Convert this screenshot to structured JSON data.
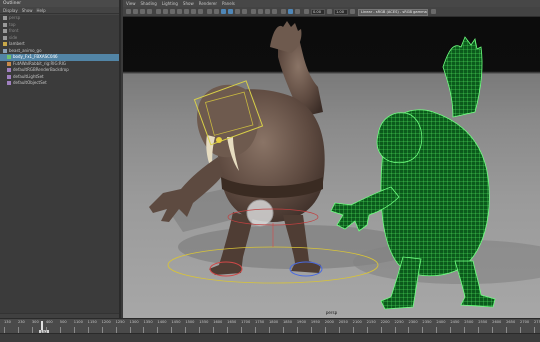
{
  "outliner": {
    "title": "Outliner",
    "menu": [
      "Display",
      "Show",
      "Help"
    ],
    "items": [
      {
        "label": "persp",
        "dim": true,
        "indent": 0,
        "icon": "camera-icon"
      },
      {
        "label": "top",
        "dim": true,
        "indent": 0,
        "icon": "camera-icon"
      },
      {
        "label": "front",
        "dim": true,
        "indent": 0,
        "icon": "camera-icon"
      },
      {
        "label": "side",
        "dim": true,
        "indent": 0,
        "icon": "camera-icon"
      },
      {
        "label": "lambert",
        "dim": false,
        "indent": 0,
        "icon": "folder-icon"
      },
      {
        "label": "beast_animo_go",
        "dim": false,
        "indent": 0,
        "icon": "group-icon"
      },
      {
        "label": "body_Fx1_FBXASC046",
        "dim": false,
        "indent": 1,
        "icon": "mesh-icon",
        "selected": true
      },
      {
        "label": "FutAWalRabbit_rig:RIG:RIG",
        "dim": false,
        "indent": 1,
        "icon": "joint-icon"
      },
      {
        "label": "defaultRGBRenderBackdrop",
        "dim": false,
        "indent": 1,
        "icon": "set-icon"
      },
      {
        "label": "defaultLightSet",
        "dim": false,
        "indent": 1,
        "icon": "set-icon"
      },
      {
        "label": "defaultObjectSet",
        "dim": false,
        "indent": 1,
        "icon": "set-icon"
      }
    ]
  },
  "viewport": {
    "menu": [
      "View",
      "Shading",
      "Lighting",
      "Show",
      "Renderer",
      "Panels"
    ],
    "field1": "0.00",
    "field2": "1.00",
    "color_space": "Linear - sRGB (ACES) - sRGB gamma (ACES)",
    "camera_label": "persp"
  },
  "timeline": {
    "ticks": [
      "130",
      "230",
      "300",
      "400",
      "500",
      "1100",
      "1150",
      "1200",
      "1250",
      "1300",
      "1350",
      "1400",
      "1450",
      "1500",
      "1550",
      "1600",
      "1650",
      "1700",
      "1750",
      "1800",
      "1850",
      "1900",
      "1950",
      "2000",
      "2050",
      "2100",
      "2150",
      "2200",
      "2250",
      "2300",
      "2350",
      "2400",
      "2450",
      "2500",
      "2550",
      "2600",
      "2650",
      "2700",
      "2750"
    ],
    "current_frame": "152"
  },
  "colors": {
    "selection": "#5285a6",
    "wireframe": "#3fe85a",
    "background_top": "#0c0c0c",
    "ground": "#9a9a9a"
  }
}
